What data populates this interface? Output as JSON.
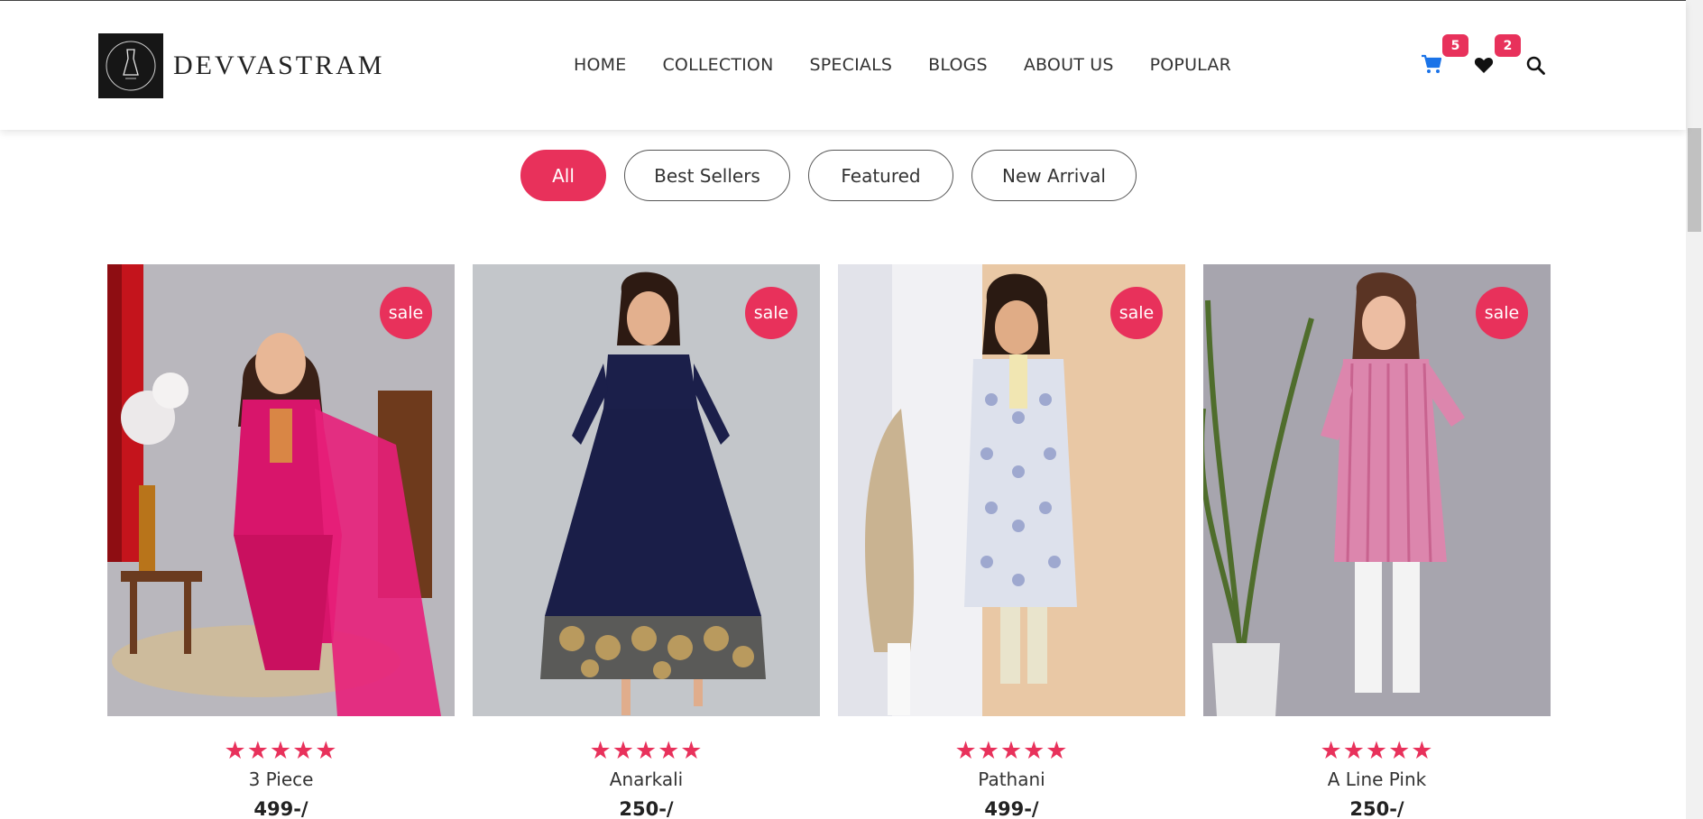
{
  "colors": {
    "accent": "#e8315b",
    "cart_icon": "#1a73e8"
  },
  "brand": {
    "name": "DEVVASTRAM",
    "logo_icon": "dress-logo-icon"
  },
  "nav": {
    "items": [
      "HOME",
      "COLLECTION",
      "SPECIALS",
      "BLOGS",
      "ABOUT US",
      "POPULAR"
    ]
  },
  "header_icons": {
    "cart": {
      "icon": "cart-icon",
      "count": "5"
    },
    "wishlist": {
      "icon": "heart-icon",
      "count": "2"
    },
    "search": {
      "icon": "search-icon"
    }
  },
  "filters": {
    "tabs": [
      {
        "label": "All",
        "active": true
      },
      {
        "label": "Best Sellers",
        "active": false
      },
      {
        "label": "Featured",
        "active": false
      },
      {
        "label": "New Arrival",
        "active": false
      }
    ]
  },
  "products": [
    {
      "badge": "sale",
      "rating": 5,
      "name": "3 Piece",
      "price": "499-/"
    },
    {
      "badge": "sale",
      "rating": 5,
      "name": "Anarkali",
      "price": "250-/"
    },
    {
      "badge": "sale",
      "rating": 5,
      "name": "Pathani",
      "price": "499-/"
    },
    {
      "badge": "sale",
      "rating": 5,
      "name": "A Line Pink",
      "price": "250-/"
    }
  ]
}
